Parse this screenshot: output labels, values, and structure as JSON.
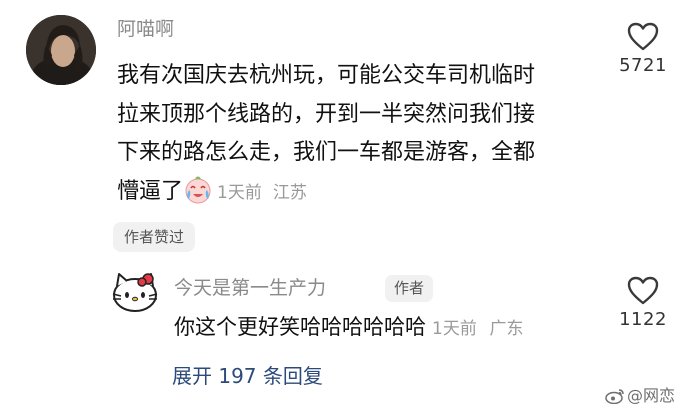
{
  "comment": {
    "username": "阿喵啊",
    "lines": [
      "我有次国庆去杭州玩，可能公交车司机临时",
      "拉来顶那个线路的，开到一半突然问我们接",
      "下来的路怎么走，我们一车都是游客，全都",
      "懵逼了"
    ],
    "emoji": "crying-laughing-face-icon",
    "time": "1天前",
    "location": "江苏",
    "author_liked_label": "作者赞过",
    "like_count": "5721"
  },
  "reply": {
    "username": "今天是第一生产力",
    "author_tag": "作者",
    "text": "你这个更好笑哈哈哈哈哈哈",
    "time": "1天前",
    "location": "广东",
    "like_count": "1122",
    "avatar": "hello-kitty-avatar"
  },
  "expand_label": "展开 197 条回复",
  "watermark": "@网恋",
  "colors": {
    "name_gray": "#8a8a8a",
    "meta_gray": "#9a9a9a",
    "link_blue": "#2c4a7a",
    "tag_bg": "#f1f1f1"
  }
}
